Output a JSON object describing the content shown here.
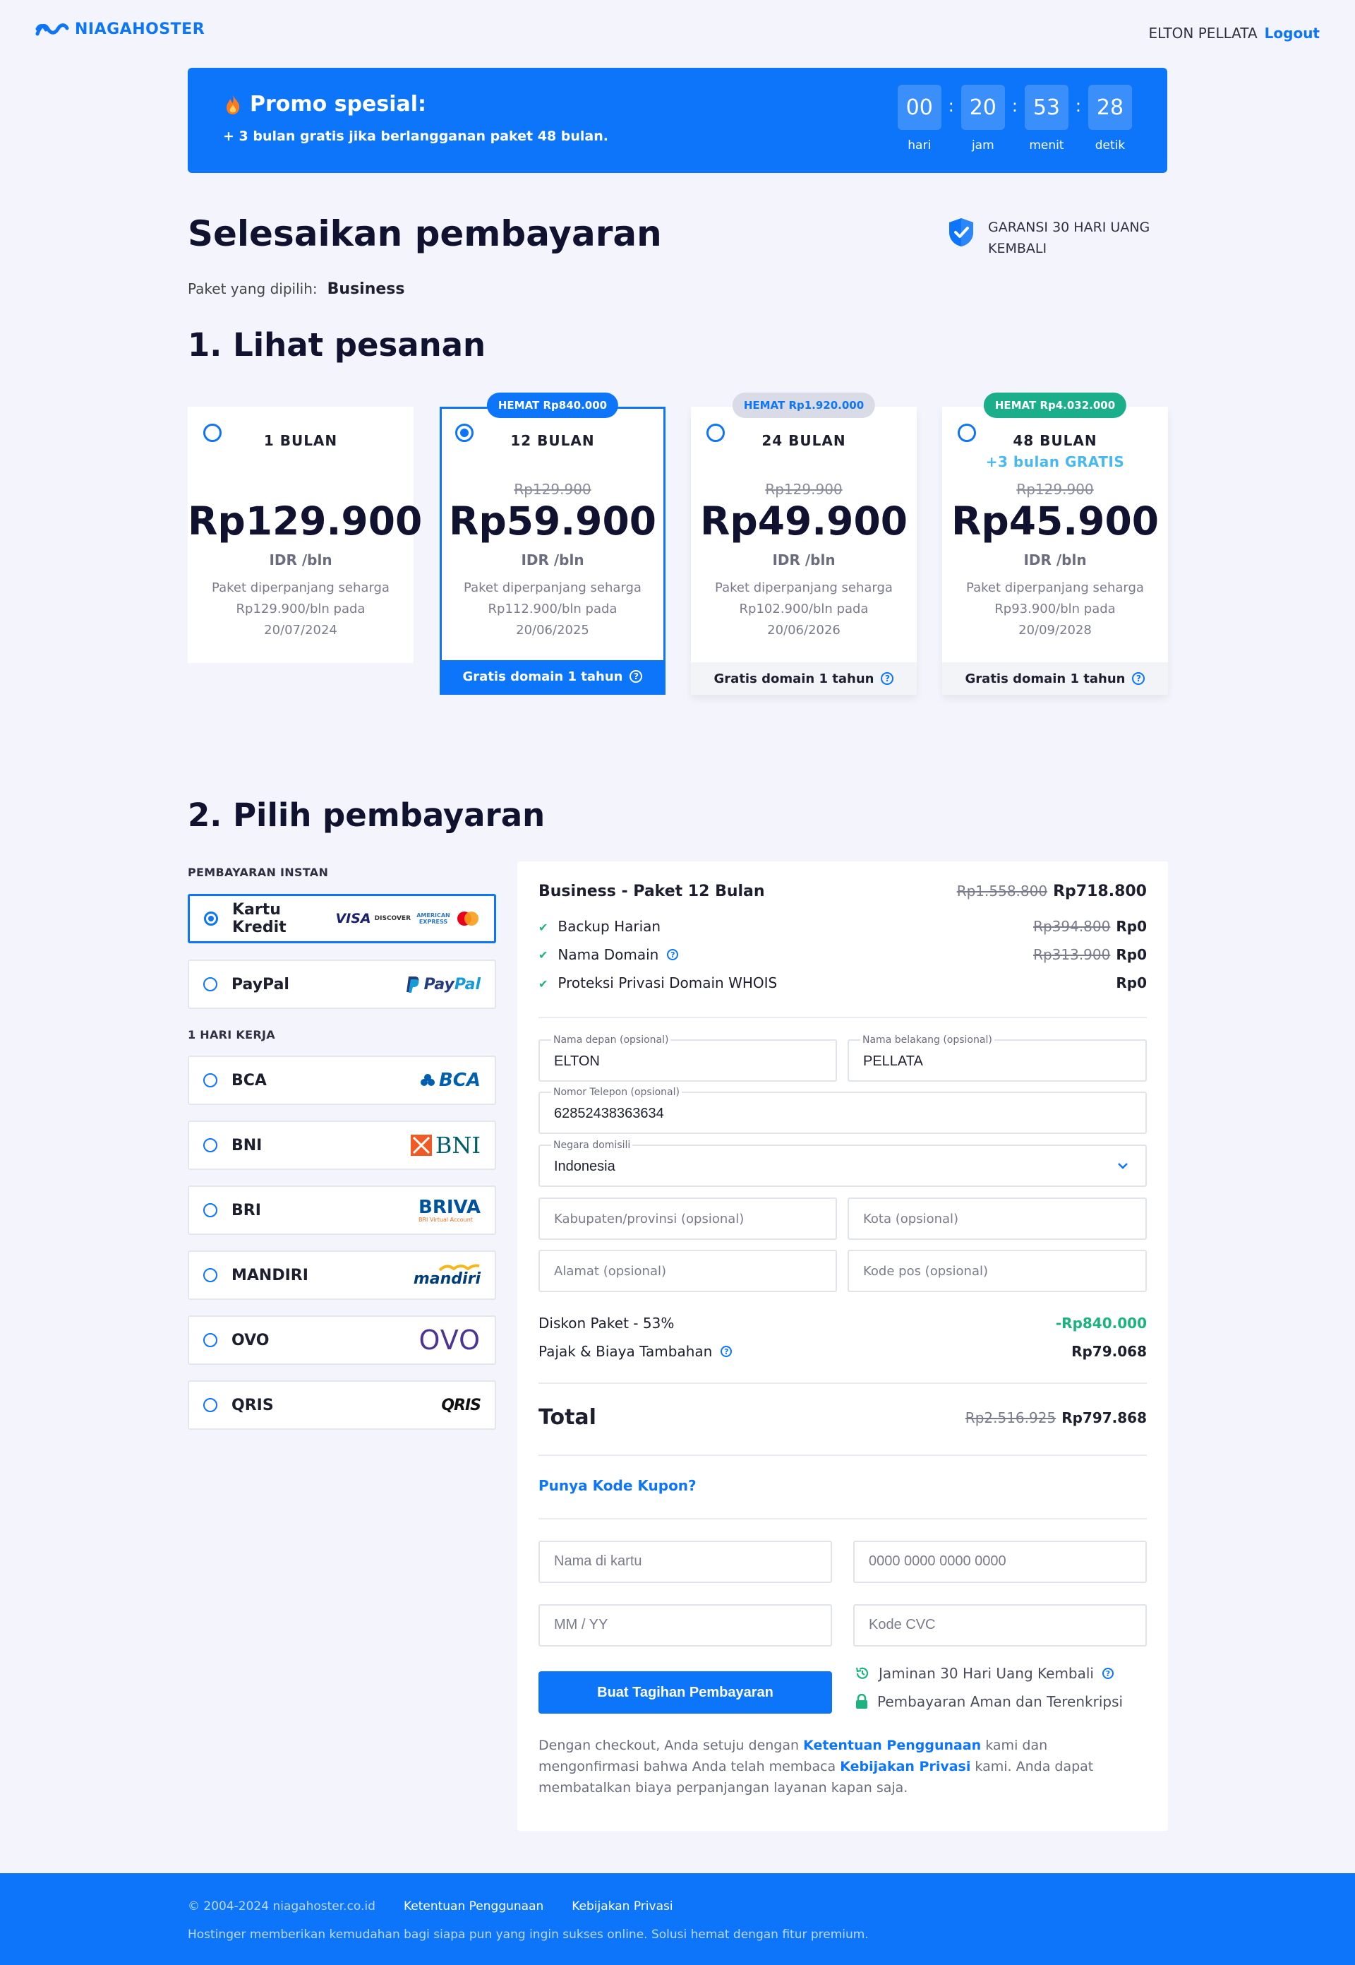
{
  "header": {
    "brand": "NIAGAHOSTER",
    "user_name": "ELTON PELLATA",
    "logout": "Logout"
  },
  "promo": {
    "title": "Promo spesial:",
    "subtitle": "+ 3 bulan gratis jika berlangganan paket 48 bulan.",
    "countdown": [
      {
        "value": "00",
        "label": "hari"
      },
      {
        "value": "20",
        "label": "jam"
      },
      {
        "value": "53",
        "label": "menit"
      },
      {
        "value": "28",
        "label": "detik"
      }
    ]
  },
  "page": {
    "title": "Selesaikan pembayaran",
    "guarantee": "GARANSI 30 HARI UANG KEMBALI",
    "selected_label": "Paket yang dipilih:",
    "selected_value": "Business",
    "step1": "1. Lihat pesanan",
    "step2": "2. Pilih pembayaran"
  },
  "plans": [
    {
      "duration": "1 BULAN",
      "old_price": "",
      "price": "Rp129.900",
      "unit": "IDR /bln",
      "note": "Paket diperpanjang seharga Rp129.900/bln pada 20/07/2024",
      "badge": "",
      "bonus": "",
      "footer": "",
      "selected": false
    },
    {
      "duration": "12 BULAN",
      "old_price": "Rp129.900",
      "price": "Rp59.900",
      "unit": "IDR /bln",
      "note": "Paket diperpanjang seharga Rp112.900/bln pada 20/06/2025",
      "badge": "HEMAT Rp840.000",
      "bonus": "",
      "footer": "Gratis domain 1 tahun",
      "selected": true
    },
    {
      "duration": "24 BULAN",
      "old_price": "Rp129.900",
      "price": "Rp49.900",
      "unit": "IDR /bln",
      "note": "Paket diperpanjang seharga Rp102.900/bln pada 20/06/2026",
      "badge": "HEMAT Rp1.920.000",
      "bonus": "",
      "footer": "Gratis domain 1 tahun",
      "selected": false
    },
    {
      "duration": "48 BULAN",
      "old_price": "Rp129.900",
      "price": "Rp45.900",
      "unit": "IDR /bln",
      "note": "Paket diperpanjang seharga Rp93.900/bln pada 20/09/2028",
      "badge": "HEMAT Rp4.032.000",
      "bonus": "+3 bulan GRATIS",
      "footer": "Gratis domain 1 tahun",
      "selected": false
    }
  ],
  "payment": {
    "instant_label": "PEMBAYARAN INSTAN",
    "workday_label": "1 HARI KERJA",
    "methods": [
      {
        "label": "Kartu Kredit",
        "logo": "card-logos",
        "selected": true
      },
      {
        "label": "PayPal",
        "logo": "paypal-logo",
        "selected": false
      },
      {
        "label": "BCA",
        "logo": "bca-logo",
        "selected": false
      },
      {
        "label": "BNI",
        "logo": "bni-logo",
        "selected": false
      },
      {
        "label": "BRI",
        "logo": "briva-logo",
        "selected": false
      },
      {
        "label": "MANDIRI",
        "logo": "mandiri-logo",
        "selected": false
      },
      {
        "label": "OVO",
        "logo": "ovo-logo",
        "selected": false
      },
      {
        "label": "QRIS",
        "logo": "qris-logo",
        "selected": false
      }
    ],
    "logo_text": {
      "visa": "VISA",
      "discover": "DISCOVER",
      "amex": "AMERICAN EXPRESS",
      "paypal_a": "Pay",
      "paypal_b": "Pal",
      "bca": "BCA",
      "bni": "BNI",
      "briva": "BRIVA",
      "briva_sub": "BRI Virtual Account",
      "mandiri": "mandiri",
      "ovo": "OVO",
      "qris": "QRIS"
    }
  },
  "summary": {
    "product": "Business - Paket 12 Bulan",
    "product_old": "Rp1.558.800",
    "product_price": "Rp718.800",
    "items": [
      {
        "label": "Backup Harian",
        "old": "Rp394.800",
        "price": "Rp0"
      },
      {
        "label": "Nama Domain",
        "old": "Rp313.900",
        "price": "Rp0"
      },
      {
        "label": "Proteksi Privasi Domain WHOIS",
        "old": "",
        "price": "Rp0"
      }
    ],
    "form": {
      "first_name_label": "Nama depan (opsional)",
      "first_name": "ELTON",
      "last_name_label": "Nama belakang (opsional)",
      "last_name": "PELLATA",
      "phone_label": "Nomor Telepon (opsional)",
      "phone": "62852438363634",
      "country_label": "Negara domisili",
      "country": "Indonesia",
      "province_ph": "Kabupaten/provinsi (opsional)",
      "city_ph": "Kota (opsional)",
      "address_ph": "Alamat (opsional)",
      "postal_ph": "Kode pos (opsional)"
    },
    "discount_label": "Diskon Paket - 53%",
    "discount_value": "-Rp840.000",
    "tax_label": "Pajak & Biaya Tambahan",
    "tax_value": "Rp79.068",
    "total_label": "Total",
    "total_old": "Rp2.516.925",
    "total_value": "Rp797.868",
    "coupon": "Punya Kode Kupon?",
    "card": {
      "name_ph": "Nama di kartu",
      "number_ph": "0000 0000 0000 0000",
      "exp_ph": "MM / YY",
      "cvc_ph": "Kode CVC"
    },
    "submit": "Buat Tagihan Pembayaran",
    "guarantee_note": "Jaminan 30 Hari Uang Kembali",
    "secure_note": "Pembayaran Aman dan Terenkripsi",
    "terms_a": "Dengan checkout, Anda setuju dengan ",
    "terms_link1": "Ketentuan Penggunaan",
    "terms_b": " kami dan mengonfirmasi bahwa Anda telah membaca ",
    "terms_link2": "Kebijakan Privasi",
    "terms_c": " kami. Anda dapat membatalkan biaya perpanjangan layanan kapan saja."
  },
  "footer": {
    "copyright": "© 2004-2024 niagahoster.co.id",
    "link1": "Ketentuan Penggunaan",
    "link2": "Kebijakan Privasi",
    "tagline": "Hostinger memberikan kemudahan bagi siapa pun yang ingin sukses online. Solusi hemat dengan fitur premium."
  },
  "colors": {
    "primary": "#0C75F9",
    "background": "#F3F4FC",
    "success": "#1CB37F",
    "badge_grey": "#D9DCE6",
    "badge_green": "#1AAE8A"
  }
}
